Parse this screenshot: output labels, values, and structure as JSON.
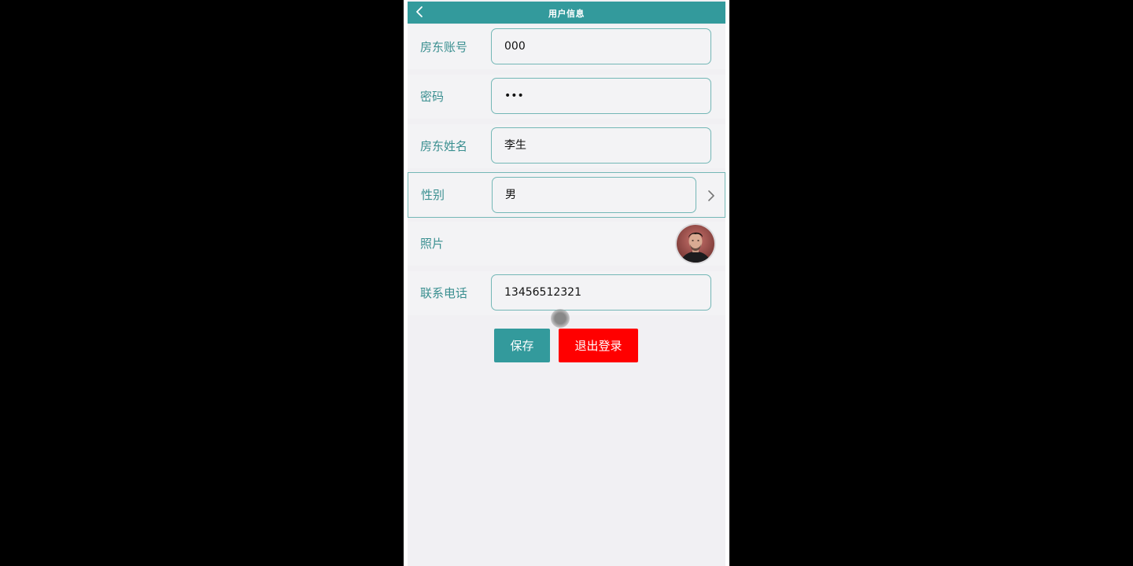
{
  "header": {
    "title": "用户信息",
    "back_icon": "chevron-left-icon"
  },
  "form": {
    "account": {
      "label": "房东账号",
      "value": "000"
    },
    "password": {
      "label": "密码",
      "value": "•••"
    },
    "name": {
      "label": "房东姓名",
      "value": "李生"
    },
    "gender": {
      "label": "性别",
      "value": "男",
      "icon": "chevron-right-icon"
    },
    "photo": {
      "label": "照片"
    },
    "phone": {
      "label": "联系电话",
      "value": "13456512321"
    }
  },
  "actions": {
    "save_label": "保存",
    "logout_label": "退出登录"
  },
  "colors": {
    "primary": "#339a9c",
    "label": "#3a8f90",
    "danger": "#ff0000",
    "page_bg": "#f1f0f3"
  }
}
